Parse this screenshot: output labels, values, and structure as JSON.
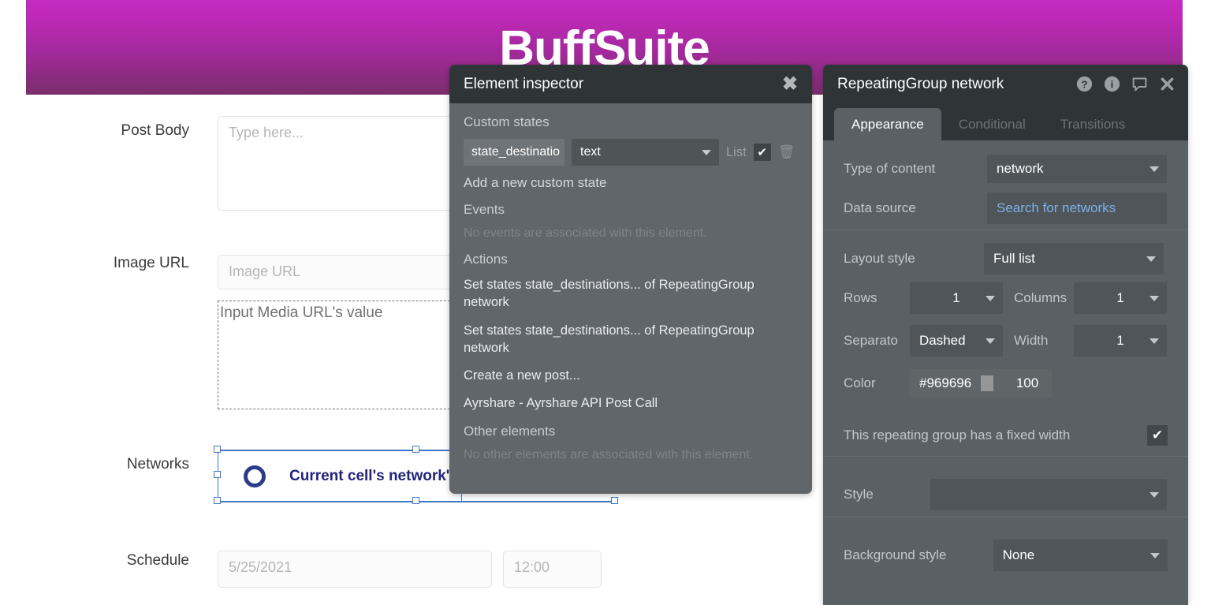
{
  "banner": {
    "title": "BuffSuite"
  },
  "form": {
    "rows": [
      {
        "label": "Post Body",
        "placeholder": "Type here..."
      },
      {
        "label": "Image URL",
        "placeholder": "Image URL"
      },
      {
        "label": "Networks"
      },
      {
        "label": "Schedule"
      }
    ],
    "dashed_box_text": "Input Media URL's value",
    "selected_cell_text": "Current cell's network's",
    "schedule_date": "5/25/2021",
    "schedule_time": "12:00"
  },
  "inspector": {
    "title": "Element inspector",
    "close_label": "✖",
    "custom_states_heading": "Custom states",
    "state": {
      "name": "state_destinatio",
      "type": "text",
      "list_label": "List",
      "list_checked": "✔",
      "delete_icon": "🗑"
    },
    "add_state_label": "Add a new custom state",
    "events_heading": "Events",
    "events_empty": "No events are associated with this element.",
    "actions_heading": "Actions",
    "actions": [
      "Set states state_destinations... of RepeatingGroup network",
      "Set states state_destinations... of RepeatingGroup network",
      "Create a new post...",
      "Ayrshare - Ayrshare API Post Call"
    ],
    "other_heading": "Other elements",
    "other_empty": "No other elements are associated with this element."
  },
  "properties": {
    "title": "RepeatingGroup network",
    "icons": [
      "help-circle-icon",
      "info-circle-icon",
      "comment-icon",
      "close-icon"
    ],
    "tabs": [
      {
        "label": "Appearance",
        "active": true
      },
      {
        "label": "Conditional",
        "active": false
      },
      {
        "label": "Transitions",
        "active": false
      }
    ],
    "type_of_content_label": "Type of content",
    "type_of_content_value": "network",
    "data_source_label": "Data source",
    "data_source_value": "Search for networks",
    "layout_style_label": "Layout style",
    "layout_style_value": "Full list",
    "rows_label": "Rows",
    "rows_value": "1",
    "columns_label": "Columns",
    "columns_value": "1",
    "separator_label": "Separato",
    "separator_value": "Dashed",
    "width_label": "Width",
    "width_value": "1",
    "color_label": "Color",
    "color_value": "#969696",
    "color_opacity": "100",
    "fixed_width_label": "This repeating group has a fixed width",
    "fixed_width_checked": "✔",
    "style_label": "Style",
    "style_value": "",
    "background_style_label": "Background style",
    "background_style_value": "None"
  },
  "colors": {
    "banner_top": "#c42bbf",
    "banner_bottom": "#7b2e6b",
    "panel_header": "#2f3437",
    "inspector_body": "#61666a",
    "props_body": "#5a6165",
    "link_blue": "#7cb1e8",
    "selection_blue": "#3f78c8",
    "cell_text": "#20247c",
    "separator_color": "#969696"
  }
}
